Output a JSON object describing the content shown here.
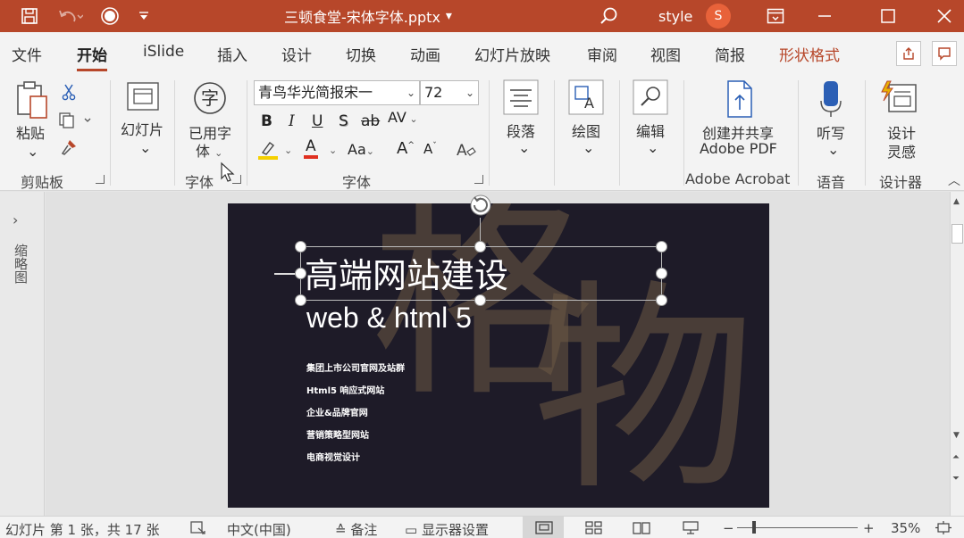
{
  "titlebar": {
    "file_title": "三顿食堂-宋体字体.pptx",
    "title_caret": "▾",
    "user_name": "style",
    "avatar_initial": "S",
    "icons": [
      "save-icon",
      "undo-icon",
      "record-icon",
      "customize-icon",
      "search-icon",
      "ribbon-display-icon",
      "minimize-icon",
      "maximize-icon",
      "close-icon"
    ]
  },
  "tabs": [
    {
      "label": "文件"
    },
    {
      "label": "开始"
    },
    {
      "label": "iSlide"
    },
    {
      "label": "插入"
    },
    {
      "label": "设计"
    },
    {
      "label": "切换"
    },
    {
      "label": "动画"
    },
    {
      "label": "幻灯片放映"
    },
    {
      "label": "审阅"
    },
    {
      "label": "视图"
    },
    {
      "label": "简报"
    },
    {
      "label": "形状格式"
    }
  ],
  "ribbon": {
    "paste_label": "粘贴",
    "clipboard_group": "剪贴板",
    "slides_label": "幻灯片",
    "used_fonts_label_1": "已用字",
    "used_fonts_label_2": "体",
    "font_group_small": "字体",
    "font_name": "青鸟华光简报宋一",
    "font_size": "72",
    "bold": "B",
    "italic": "I",
    "underline": "U",
    "shadow": "S",
    "strike": "ab",
    "spacing": "AV",
    "aa": "Aa",
    "grow": "A",
    "shrink": "A",
    "font_color": "A",
    "font_group": "字体",
    "paragraph_label": "段落",
    "drawing_label": "绘图",
    "editing_label": "编辑",
    "adobe_label_1": "创建并共享",
    "adobe_label_2": "Adobe PDF",
    "adobe_group": "Adobe Acrobat",
    "dictate_label": "听写",
    "voice_group": "语音",
    "designer_label_1": "设计",
    "designer_label_2": "灵感",
    "designer_group": "设计器",
    "char_icon": "字"
  },
  "leftpanel": {
    "label": "缩略图",
    "arrow": "›"
  },
  "slide": {
    "bg_chars": [
      "格",
      "物"
    ],
    "title": "高端网站建设",
    "subtitle": "web & html 5",
    "items": [
      "集团上市公司官网及站群",
      "Html5 响应式网站",
      "企业&品牌官网",
      "营销策略型网站",
      "电商视觉设计"
    ]
  },
  "status": {
    "slide_info": "幻灯片 第 1 张，共 17 张",
    "language": "中文(中国)",
    "notes": "备注",
    "display_settings": "显示器设置",
    "zoom_minus": "−",
    "zoom_plus": "+",
    "zoom": "35%"
  },
  "colors": {
    "brand": "#b7472a",
    "slide_bg": "#1e1b28",
    "highlight_yellow": "#f5d000",
    "font_red": "#e03020"
  }
}
